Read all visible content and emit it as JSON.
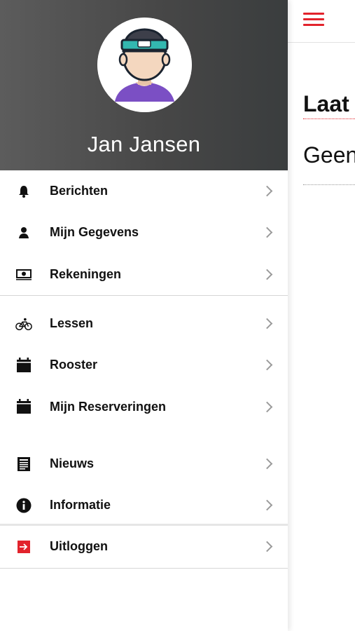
{
  "user": {
    "name": "Jan Jansen"
  },
  "menu": {
    "group1": [
      {
        "label": "Berichten",
        "icon": "bell-icon"
      },
      {
        "label": "Mijn Gegevens",
        "icon": "person-icon"
      },
      {
        "label": "Rekeningen",
        "icon": "money-icon"
      }
    ],
    "group2": [
      {
        "label": "Lessen",
        "icon": "bicycle-icon"
      },
      {
        "label": "Rooster",
        "icon": "calendar-icon"
      },
      {
        "label": "Mijn Reserveringen",
        "icon": "calendar-icon"
      }
    ],
    "group3": [
      {
        "label": "Nieuws",
        "icon": "newspaper-icon"
      },
      {
        "label": "Informatie",
        "icon": "info-icon"
      }
    ],
    "logout": {
      "label": "Uitloggen",
      "icon": "logout-icon"
    }
  },
  "main": {
    "title": "Laat",
    "empty_text": "Geen"
  },
  "colors": {
    "accent": "#e2232c",
    "header_bg": "#474747"
  }
}
